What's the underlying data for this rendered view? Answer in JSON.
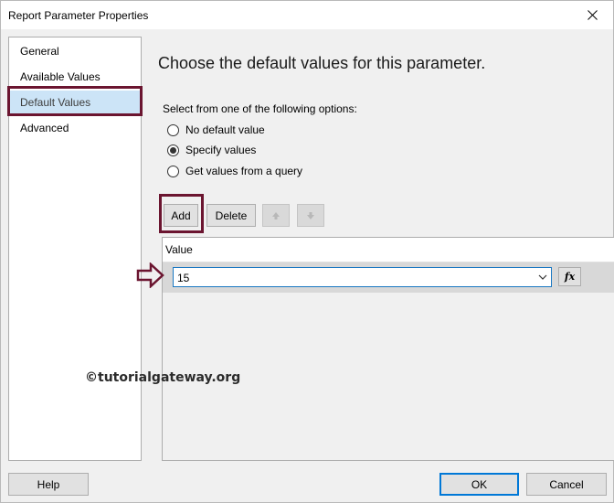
{
  "window": {
    "title": "Report Parameter Properties"
  },
  "nav": {
    "items": [
      {
        "label": "General",
        "selected": false
      },
      {
        "label": "Available Values",
        "selected": false
      },
      {
        "label": "Default Values",
        "selected": true
      },
      {
        "label": "Advanced",
        "selected": false
      }
    ]
  },
  "main": {
    "heading": "Choose the default values for this parameter.",
    "options_label": "Select from one of the following options:",
    "options": [
      {
        "label": "No default value",
        "checked": false
      },
      {
        "label": "Specify values",
        "checked": true
      },
      {
        "label": "Get values from a query",
        "checked": false
      }
    ],
    "toolbar": {
      "add_label": "Add",
      "delete_label": "Delete",
      "move_up_icon": "arrow-up-icon",
      "move_down_icon": "arrow-down-icon"
    },
    "grid": {
      "column_header": "Value",
      "rows": [
        {
          "value": "15"
        }
      ],
      "expression_button_label": "fx"
    }
  },
  "watermark": "©tutorialgateway.org",
  "footer": {
    "help_label": "Help",
    "ok_label": "OK",
    "cancel_label": "Cancel"
  },
  "colors": {
    "highlight": "#6b1530",
    "selection": "#cce4f7",
    "focus": "#0078d7"
  }
}
